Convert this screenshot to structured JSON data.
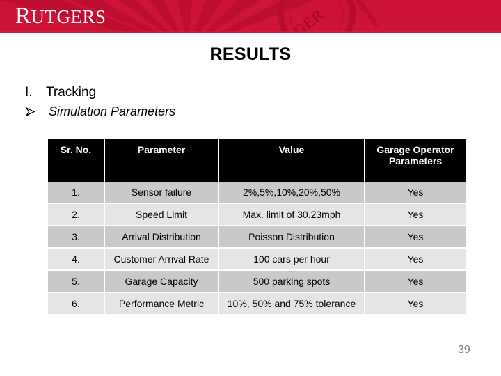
{
  "header": {
    "brand": "RUTGERS",
    "brand_initial": "R",
    "brand_rest": "UTGERS",
    "band_color": "#cf1336",
    "watermark": "rutgers-seal-rays-watermark"
  },
  "slide": {
    "title": "RESULTS",
    "page_number": "39"
  },
  "outline": {
    "items": [
      {
        "marker": "I.",
        "text": "Tracking",
        "style": "underline"
      },
      {
        "marker": "arrow-bullet-icon",
        "text": "Simulation Parameters",
        "style": "italic"
      }
    ]
  },
  "table": {
    "headers": [
      "Sr. No.",
      "Parameter",
      "Value",
      "Garage Operator Parameters"
    ],
    "header_bg": "#000000",
    "header_fg": "#ffffff",
    "row_bg_odd": "#c9c9c9",
    "row_bg_even": "#e5e5e5",
    "rows": [
      {
        "sr": "1.",
        "parameter": "Sensor failure",
        "value": "2%,5%,10%,20%,50%",
        "garage": "Yes"
      },
      {
        "sr": "2.",
        "parameter": "Speed Limit",
        "value": "Max. limit of 30.23mph",
        "garage": "Yes"
      },
      {
        "sr": "3.",
        "parameter": "Arrival Distribution",
        "value": "Poisson Distribution",
        "garage": "Yes"
      },
      {
        "sr": "4.",
        "parameter": "Customer Arrival Rate",
        "value": "100 cars per hour",
        "garage": "Yes"
      },
      {
        "sr": "5.",
        "parameter": "Garage Capacity",
        "value": "500 parking spots",
        "garage": "Yes"
      },
      {
        "sr": "6.",
        "parameter": "Performance Metric",
        "value": "10%, 50% and 75% tolerance",
        "garage": "Yes"
      }
    ]
  }
}
